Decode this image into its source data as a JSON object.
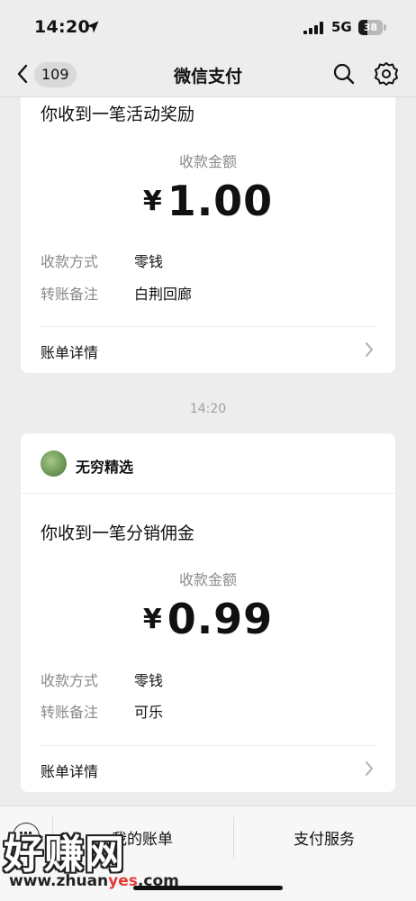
{
  "status_bar": {
    "time": "14:20",
    "network": "5G",
    "battery_level": 38,
    "battery_text": "38"
  },
  "nav": {
    "unread_count": "109",
    "title": "微信支付"
  },
  "messages": [
    {
      "title": "你收到一笔活动奖励",
      "amount_label": "收款金额",
      "currency": "¥",
      "amount": "1.00",
      "rows": [
        {
          "key": "收款方式",
          "value": "零钱"
        },
        {
          "key": "转账备注",
          "value": "白荆回廊"
        }
      ],
      "detail_label": "账单详情"
    },
    {
      "timestamp": "14:20",
      "sender": "无穷精选",
      "title": "你收到一笔分销佣金",
      "amount_label": "收款金额",
      "currency": "¥",
      "amount": "0.99",
      "rows": [
        {
          "key": "收款方式",
          "value": "零钱"
        },
        {
          "key": "转账备注",
          "value": "可乐"
        }
      ],
      "detail_label": "账单详情"
    }
  ],
  "bottom_menu": {
    "items": [
      "我的账单",
      "支付服务"
    ]
  },
  "watermark": {
    "text": "好赚网",
    "url_prefix": "www.zhuan",
    "url_highlight": "yes",
    "url_suffix": ".com"
  }
}
